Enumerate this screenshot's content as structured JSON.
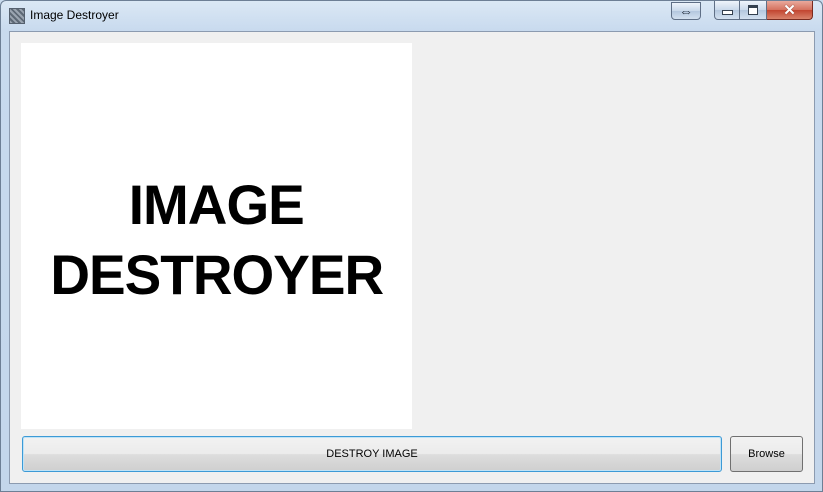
{
  "window": {
    "title": "Image Destroyer",
    "icon": "app-noise-icon",
    "controls": {
      "resize": "⇔",
      "close": "✕"
    }
  },
  "picture": {
    "line1": "IMAGE",
    "line2": "DESTROYER"
  },
  "buttons": {
    "destroy_label": "DESTROY IMAGE",
    "browse_label": "Browse"
  },
  "colors": {
    "focus_border": "#3c9ad6",
    "client_bg": "#f0f0f0",
    "close_button": "#c24530"
  }
}
